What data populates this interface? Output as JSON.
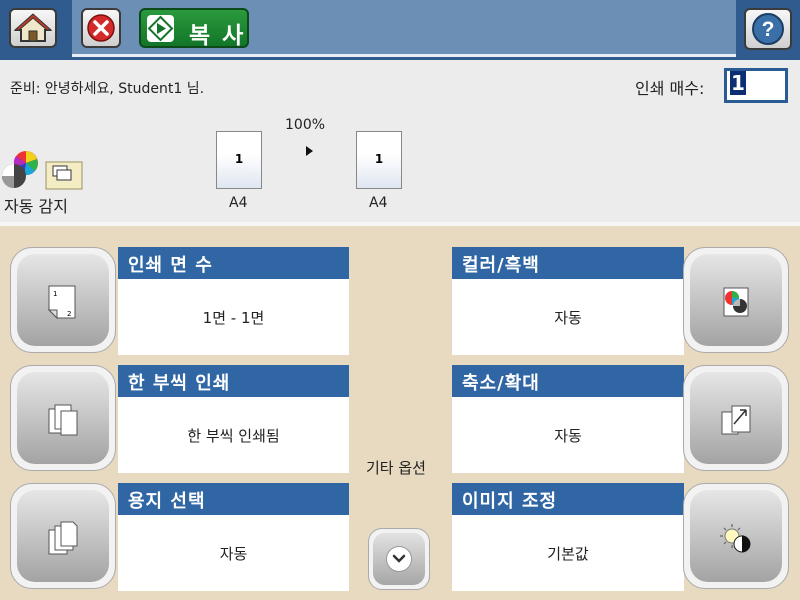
{
  "header": {
    "home_icon": "home-icon",
    "stop_icon": "stop-icon",
    "copy_label": "복 사",
    "help_icon": "help-icon"
  },
  "status": {
    "ready_text": "준비: 안녕하세요, Student1 님.",
    "copies_label": "인쇄 매수:",
    "copies_value": "1",
    "zoom": "100%",
    "original_page": "1",
    "output_page": "1",
    "original_size": "A4",
    "output_size": "A4",
    "color_mode_label": "자동 감지"
  },
  "options": {
    "sides_title": "인쇄 면 수",
    "sides_value": "1면 - 1면",
    "collate_title": "한 부씩 인쇄",
    "collate_value": "한 부씩 인쇄됨",
    "paper_title": "용지 선택",
    "paper_value": "자동",
    "color_title": "컬러/흑백",
    "color_value": "자동",
    "reduce_title": "축소/확대",
    "reduce_value": "자동",
    "image_title": "이미지 조정",
    "image_value": "기본값",
    "more_label": "기타 옵션"
  },
  "colors": {
    "header_dark": "#2f5b8f",
    "header_light": "#6b8fb5",
    "title_bar": "#2f66a3",
    "background": "#e8d9c1",
    "copy_green": "#1f8a34"
  }
}
